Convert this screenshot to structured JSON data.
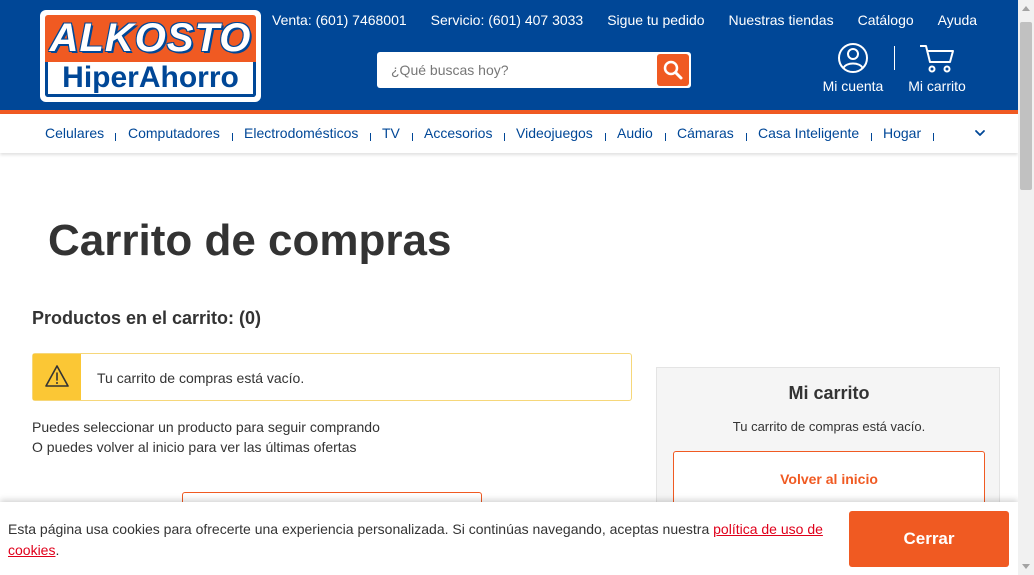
{
  "brand": {
    "logo_top": "ALKOSTO",
    "logo_bottom": "HiperAhorro"
  },
  "topnav": [
    {
      "label": "Venta: (601) 7468001"
    },
    {
      "label": "Servicio: (601) 407 3033"
    },
    {
      "label": "Sigue tu pedido"
    },
    {
      "label": "Nuestras tiendas"
    },
    {
      "label": "Catálogo"
    },
    {
      "label": "Ayuda"
    }
  ],
  "search": {
    "placeholder": "¿Qué buscas hoy?",
    "value": "",
    "icon": "search-icon"
  },
  "account": {
    "label": "Mi cuenta",
    "icon": "user-icon"
  },
  "cart": {
    "label": "Mi carrito",
    "icon": "cart-icon"
  },
  "categories": [
    {
      "label": "Celulares"
    },
    {
      "label": "Computadores"
    },
    {
      "label": "Electrodomésticos"
    },
    {
      "label": "TV"
    },
    {
      "label": "Accesorios"
    },
    {
      "label": "Videojuegos"
    },
    {
      "label": "Audio"
    },
    {
      "label": "Cámaras"
    },
    {
      "label": "Casa Inteligente"
    },
    {
      "label": "Hogar"
    }
  ],
  "main": {
    "title": "Carrito de compras",
    "products_count": "Productos en el carrito: (0)",
    "alert_text": "Tu carrito de compras está vacío.",
    "alert_icon": "warning-icon",
    "hint_line1": "Puedes seleccionar un producto para seguir comprando",
    "hint_line2": "O puedes volver al inicio para ver las últimas ofertas"
  },
  "summary": {
    "title": "Mi carrito",
    "empty_text": "Tu carrito de compras está vacío.",
    "back_button": "Volver al inicio"
  },
  "cookie": {
    "text": "Esta página usa cookies para ofrecerte una experiencia personalizada. Si continúas navegando, aceptas nuestra ",
    "link": "política de uso de cookies",
    "suffix": ".",
    "button": "Cerrar"
  },
  "colors": {
    "brand_blue": "#004797",
    "brand_orange": "#f05a22",
    "alert_yellow": "#fbc735",
    "link_red": "#e0001b"
  }
}
